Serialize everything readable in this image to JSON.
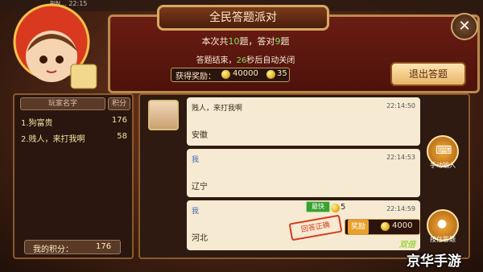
{
  "status_bar": {
    "text": "PIN... 22:15"
  },
  "title": "全民答题派对",
  "info": {
    "line1_prefix": "本次共",
    "total": "10",
    "line1_mid": "题，答对",
    "correct": "9",
    "line1_suffix": "题",
    "line2_prefix": "答题结束，",
    "countdown": "26",
    "line2_suffix": "秒后自动关闭"
  },
  "reward": {
    "label": "获得奖励：",
    "coins": "40000",
    "gems": "35"
  },
  "exit_button": "退出答题",
  "close_icon": "✕",
  "players": {
    "col_name": "玩家名字",
    "col_score": "积分",
    "rows": [
      {
        "name": "1.狗富贵",
        "score": "176"
      },
      {
        "name": "2.贱人，来打我啊",
        "score": "58"
      }
    ],
    "my_score_label": "我的积分：",
    "my_score": "176"
  },
  "chat": [
    {
      "name": "贱人，来打我啊",
      "time": "22:14:50",
      "text": "安徽"
    },
    {
      "name": "我",
      "time": "22:14:53",
      "text": "辽宁"
    },
    {
      "name": "我",
      "time": "22:14:59",
      "text": "河北"
    }
  ],
  "answer_result": {
    "fast_label": "最快",
    "fast_points": "5",
    "stamp": "回答正确",
    "reward_label": "奖励",
    "reward_coins": "4000",
    "double": "双倍"
  },
  "side_buttons": {
    "keyboard": "手动输入",
    "voice": "按住答题"
  },
  "watermark": "京华手游"
}
